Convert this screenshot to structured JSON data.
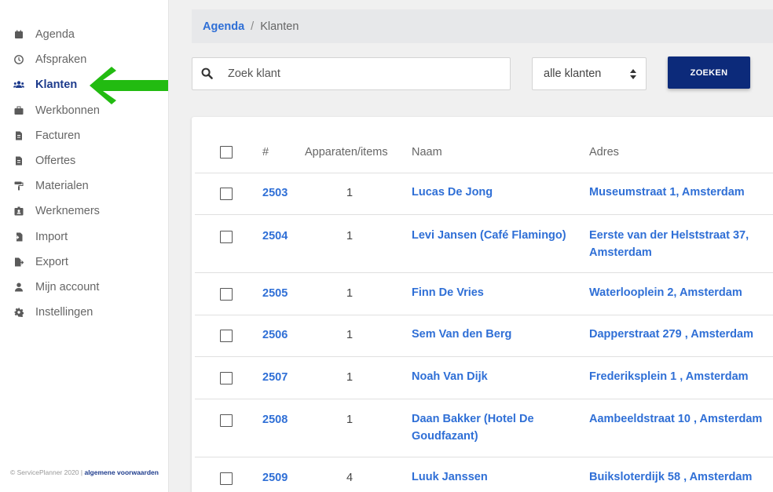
{
  "sidebar": {
    "items": [
      {
        "label": "Agenda",
        "icon": "calendar-icon"
      },
      {
        "label": "Afspraken",
        "icon": "clock-icon"
      },
      {
        "label": "Klanten",
        "icon": "users-icon",
        "active": true
      },
      {
        "label": "Werkbonnen",
        "icon": "briefcase-icon"
      },
      {
        "label": "Facturen",
        "icon": "invoice-icon"
      },
      {
        "label": "Offertes",
        "icon": "quote-icon"
      },
      {
        "label": "Materialen",
        "icon": "paint-roller-icon"
      },
      {
        "label": "Werknemers",
        "icon": "id-badge-icon"
      },
      {
        "label": "Import",
        "icon": "import-icon"
      },
      {
        "label": "Export",
        "icon": "export-icon"
      },
      {
        "label": "Mijn account",
        "icon": "user-icon"
      },
      {
        "label": "Instellingen",
        "icon": "gear-icon"
      }
    ],
    "footer_text": "© ServicePlanner 2020 | ",
    "footer_link": "algemene voorwaarden"
  },
  "breadcrumb": {
    "link": "Agenda",
    "separator": "/",
    "current": "Klanten"
  },
  "search": {
    "placeholder": "Zoek klant",
    "value": ""
  },
  "filter": {
    "selected": "alle klanten"
  },
  "search_button": "ZOEKEN",
  "table": {
    "headers": {
      "id": "#",
      "items": "Apparaten/items",
      "naam": "Naam",
      "adres": "Adres"
    },
    "rows": [
      {
        "id": "2503",
        "items": "1",
        "naam": "Lucas De Jong",
        "adres": "Museumstraat 1, Amsterdam"
      },
      {
        "id": "2504",
        "items": "1",
        "naam": "Levi Jansen (Café Flamingo)",
        "adres": "Eerste van der Helststraat 37, Amsterdam"
      },
      {
        "id": "2505",
        "items": "1",
        "naam": "Finn De Vries",
        "adres": "Waterlooplein 2, Amsterdam"
      },
      {
        "id": "2506",
        "items": "1",
        "naam": "Sem Van den Berg",
        "adres": "Dapperstraat 279 , Amsterdam"
      },
      {
        "id": "2507",
        "items": "1",
        "naam": "Noah Van Dijk",
        "adres": "Frederiksplein 1 , Amsterdam"
      },
      {
        "id": "2508",
        "items": "1",
        "naam": "Daan Bakker (Hotel De Goudfazant)",
        "adres": "Aambeeldstraat 10 , Amsterdam"
      },
      {
        "id": "2509",
        "items": "4",
        "naam": "Luuk Janssen",
        "adres": "Buiksloterdijk 58 , Amsterdam"
      }
    ]
  },
  "colors": {
    "accent": "#2f6fd6",
    "primary_button": "#0c2a7a",
    "active_nav": "#1d3b8c",
    "arrow": "#22bb11"
  }
}
